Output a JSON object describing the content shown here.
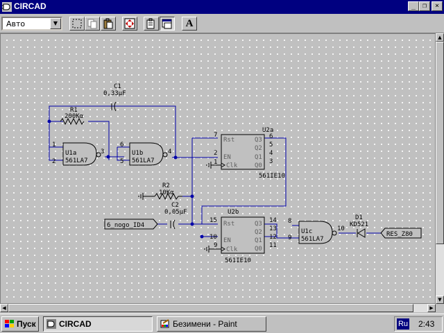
{
  "window": {
    "title": "CIRCAD",
    "minimize_glyph": "_",
    "maximize_glyph": "❐",
    "close_glyph": "×"
  },
  "toolbar": {
    "mode_value": "Авто",
    "buttons": [
      "select-rect-icon",
      "copy-icon",
      "paste-icon",
      "move-icon",
      "properties-icon",
      "window-icon",
      "text-icon"
    ],
    "text_button_label": "A"
  },
  "schematic": {
    "capacitor_c1": {
      "ref": "C1",
      "value": "0,33µF"
    },
    "resistor_r1": {
      "ref": "R1",
      "value": "200Kα"
    },
    "gate_u1a": {
      "ref": "U1a",
      "part": "561LA7",
      "pins": [
        "1",
        "2",
        "3"
      ]
    },
    "gate_u1b": {
      "ref": "U1b",
      "part": "561LA7",
      "pins": [
        "6",
        "5",
        "4"
      ]
    },
    "counter_u2a": {
      "ref": "U2a",
      "part": "561IE10",
      "inputs": [
        "Rst",
        "EN",
        "Clk"
      ],
      "input_pins": [
        "7",
        "2",
        "1"
      ],
      "outputs": [
        "Q3",
        "Q2",
        "Q1",
        "Q0"
      ],
      "output_pins": [
        "6",
        "5",
        "4",
        "3"
      ]
    },
    "resistor_r2": {
      "ref": "R2",
      "value": "10Kα"
    },
    "capacitor_c2": {
      "ref": "C2",
      "value": "0,05µF"
    },
    "input_port": "6_nogo_ID4",
    "counter_u2b": {
      "ref": "U2b",
      "part": "561IE10",
      "inputs": [
        "Rst",
        "EN",
        "Clk"
      ],
      "input_pins": [
        "15",
        "10",
        "9"
      ],
      "outputs": [
        "Q3",
        "Q2",
        "Q1",
        "Q0"
      ],
      "output_pins": [
        "14",
        "13",
        "12",
        "11"
      ]
    },
    "gate_u1c": {
      "ref": "U1c",
      "part": "561LA7",
      "pins": [
        "8",
        "9",
        "10"
      ]
    },
    "diode_d1": {
      "ref": "D1",
      "part": "KD521"
    },
    "output_port": "RES_Z80"
  },
  "taskbar": {
    "start_label": "Пуск",
    "tasks": [
      {
        "label": "CIRCAD",
        "icon": "circad-app-icon",
        "active": true
      },
      {
        "label": "Безимени - Paint",
        "icon": "paint-app-icon",
        "active": false
      }
    ],
    "language": "Ru",
    "clock": "2:43"
  },
  "colors": {
    "wire": "#0000a8",
    "title_bar": "#000080",
    "canvas": "#c0c0c0",
    "component": "#000000"
  }
}
